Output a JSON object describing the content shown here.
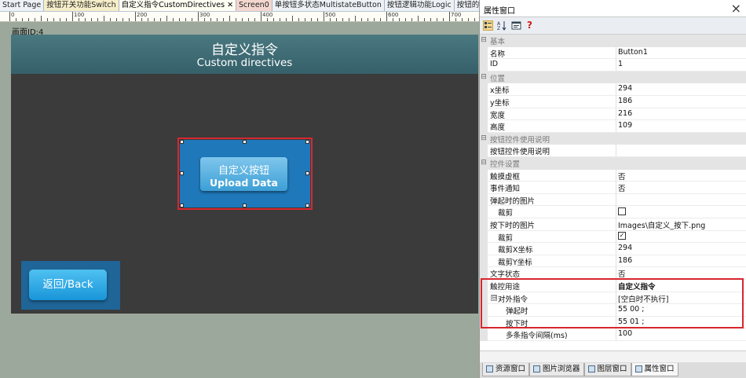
{
  "tabs": [
    {
      "label": "Start Page",
      "style": "normal"
    },
    {
      "label": "按钮开关功能Switch",
      "style": "yellow"
    },
    {
      "label": "自定义指令CustomDirectives",
      "style": "active",
      "close": "✕"
    },
    {
      "label": "Screen0",
      "style": "pink"
    },
    {
      "label": "单按钮多状态MultistateButton",
      "style": "normal"
    },
    {
      "label": "按钮逻辑功能Logic",
      "style": "normal"
    },
    {
      "label": "按钮的禁止与使",
      "style": "normal"
    }
  ],
  "ruler": {
    "labels": [
      "0",
      "100",
      "200",
      "300",
      "400",
      "500",
      "600",
      "700"
    ]
  },
  "canvas": {
    "screen_label": "画面ID:4",
    "title": "自定义指令",
    "subtitle": "Custom directives",
    "main_button": {
      "label_zh": "自定义按钮",
      "label_en": "Upload Data"
    },
    "back_button": {
      "label": "返回/Back"
    }
  },
  "properties": {
    "title": "属性窗口",
    "close": "×",
    "toolbar_icons": [
      "categorized-icon",
      "sort-az-icon",
      "property-pages-icon",
      "help-icon"
    ],
    "rows": [
      {
        "kind": "cat",
        "name": "基本"
      },
      {
        "kind": "prop",
        "name": "名称",
        "value": "Button1"
      },
      {
        "kind": "prop",
        "name": "ID",
        "value": "1"
      },
      {
        "kind": "cat",
        "name": "位置"
      },
      {
        "kind": "prop",
        "name": "x坐标",
        "value": "294"
      },
      {
        "kind": "prop",
        "name": "y坐标",
        "value": "186"
      },
      {
        "kind": "prop",
        "name": "宽度",
        "value": "216"
      },
      {
        "kind": "prop",
        "name": "高度",
        "value": "109"
      },
      {
        "kind": "cat",
        "name": "按钮控件使用说明"
      },
      {
        "kind": "prop",
        "name": "按钮控件使用说明",
        "value": ""
      },
      {
        "kind": "cat",
        "name": "控件设置"
      },
      {
        "kind": "prop",
        "name": "触摸虚框",
        "value": "否"
      },
      {
        "kind": "prop",
        "name": "事件通知",
        "value": "否"
      },
      {
        "kind": "prop",
        "name": "弹起时的图片",
        "value": ""
      },
      {
        "kind": "prop",
        "name": "裁剪",
        "value": "",
        "checkbox": false,
        "indent": 1
      },
      {
        "kind": "prop",
        "name": "按下时的图片",
        "value": "Images\\自定义_按下.png"
      },
      {
        "kind": "prop",
        "name": "裁剪",
        "value": "",
        "checkbox": true,
        "indent": 1
      },
      {
        "kind": "prop",
        "name": "裁剪X坐标",
        "value": "294",
        "indent": 1
      },
      {
        "kind": "prop",
        "name": "裁剪Y坐标",
        "value": "186",
        "indent": 1
      },
      {
        "kind": "prop",
        "name": "文字状态",
        "value": "否"
      },
      {
        "kind": "prop",
        "name": "触控用途",
        "value": "自定义指令",
        "bold": true
      },
      {
        "kind": "prop",
        "name": "对外指令",
        "value": "[空白时不执行]",
        "expander": "⊟"
      },
      {
        "kind": "prop",
        "name": "弹起时",
        "value": "55 00 ;",
        "indent": 2
      },
      {
        "kind": "prop",
        "name": "按下时",
        "value": "55 01 ;",
        "indent": 2
      },
      {
        "kind": "prop",
        "name": "多条指令间隔(ms)",
        "value": "100",
        "indent": 2
      }
    ]
  },
  "bottom_tabs": [
    {
      "label": "资源窗口",
      "icon": "resource-icon"
    },
    {
      "label": "图片浏览器",
      "icon": "image-icon"
    },
    {
      "label": "图层窗口",
      "icon": "layer-icon"
    },
    {
      "label": "属性窗口",
      "icon": "property-icon",
      "active": true
    }
  ],
  "colors": {
    "selection": "#d8262e",
    "button_frame": "#1f78ba"
  }
}
